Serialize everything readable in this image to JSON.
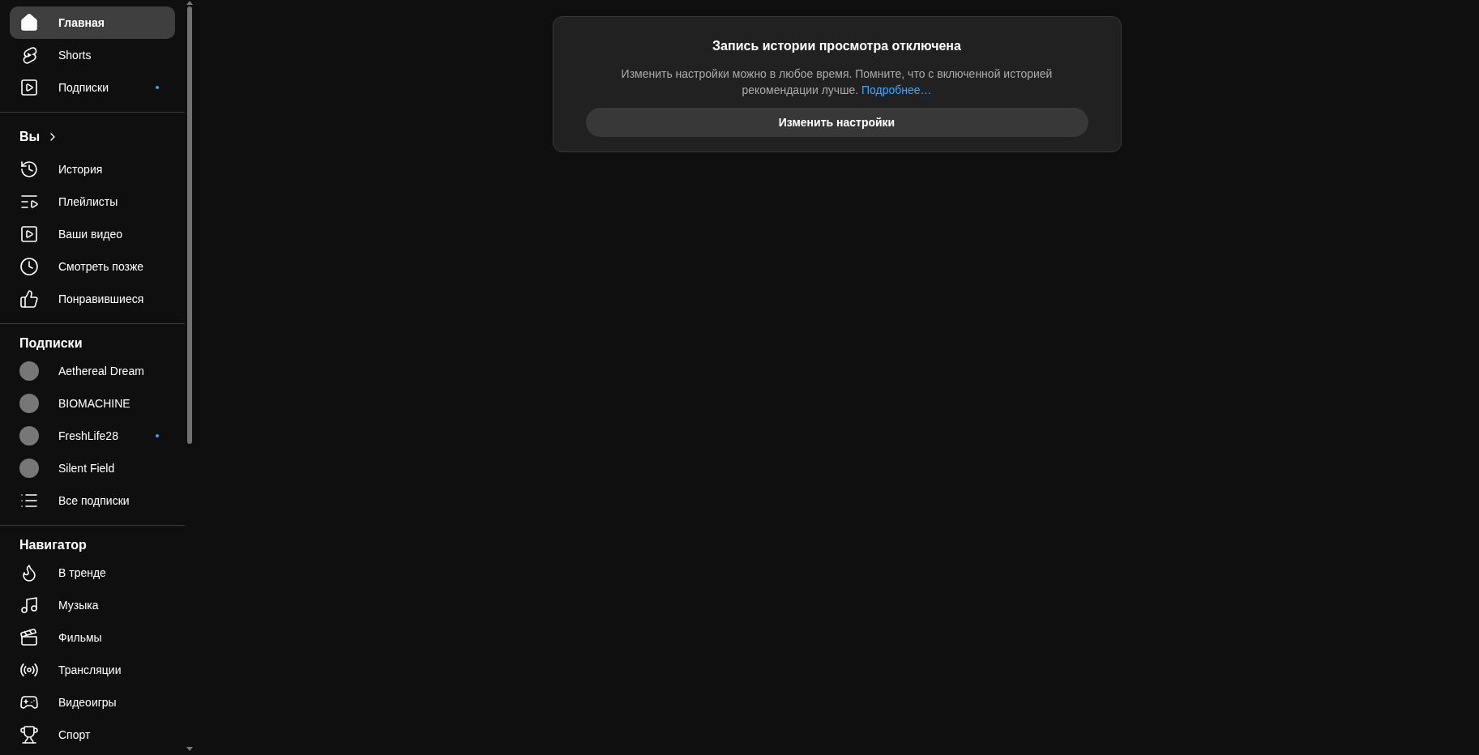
{
  "sidebar": {
    "sections": [
      {
        "items": [
          {
            "label": "Главная",
            "kind": "link",
            "selected": true,
            "new": false
          },
          {
            "label": "Shorts",
            "kind": "link",
            "selected": false,
            "new": false
          },
          {
            "label": "Подписки",
            "kind": "link",
            "selected": false,
            "new": true
          }
        ]
      },
      {
        "heading": "Вы",
        "heading_link": true,
        "items": [
          {
            "label": "История",
            "kind": "link",
            "selected": false,
            "new": false
          },
          {
            "label": "Плейлисты",
            "kind": "link",
            "selected": false,
            "new": false
          },
          {
            "label": "Ваши видео",
            "kind": "link",
            "selected": false,
            "new": false
          },
          {
            "label": "Смотреть позже",
            "kind": "link",
            "selected": false,
            "new": false
          },
          {
            "label": "Понравившиеся",
            "kind": "link",
            "selected": false,
            "new": false
          }
        ]
      },
      {
        "heading": "Подписки",
        "heading_link": false,
        "items": [
          {
            "label": "Aethereal Dream",
            "kind": "channel",
            "selected": false,
            "new": false
          },
          {
            "label": "BIOMACHINE",
            "kind": "channel",
            "selected": false,
            "new": false
          },
          {
            "label": "FreshLife28",
            "kind": "channel",
            "selected": false,
            "new": true
          },
          {
            "label": "Silent Field",
            "kind": "channel",
            "selected": false,
            "new": false
          },
          {
            "label": "Все подписки",
            "kind": "link",
            "selected": false,
            "new": false
          }
        ]
      },
      {
        "heading": "Навигатор",
        "heading_link": false,
        "items": [
          {
            "label": "В тренде",
            "kind": "link",
            "selected": false,
            "new": false
          },
          {
            "label": "Музыка",
            "kind": "link",
            "selected": false,
            "new": false
          },
          {
            "label": "Фильмы",
            "kind": "link",
            "selected": false,
            "new": false
          },
          {
            "label": "Трансляции",
            "kind": "link",
            "selected": false,
            "new": false
          },
          {
            "label": "Видеоигры",
            "kind": "link",
            "selected": false,
            "new": false
          },
          {
            "label": "Спорт",
            "kind": "link",
            "selected": false,
            "new": false
          }
        ]
      }
    ]
  },
  "notice": {
    "title": "Запись истории просмотра отключена",
    "text": "Изменить настройки можно в любое время. Помните, что с включенной историей рекомендации лучше.",
    "link": "Подробнее…",
    "button": "Изменить настройки"
  }
}
